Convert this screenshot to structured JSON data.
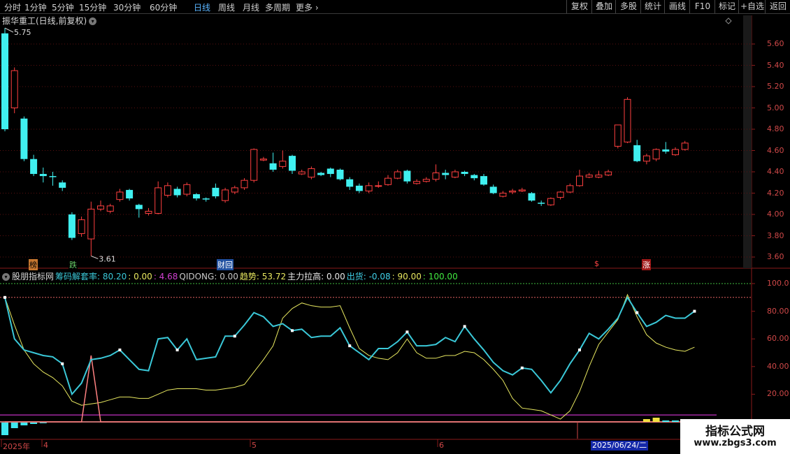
{
  "toolbar": {
    "periods": [
      "分时",
      "1分钟",
      "5分钟",
      "15分钟",
      "30分钟",
      "60分钟",
      "日线",
      "周线",
      "月线",
      "多周期",
      "更多"
    ],
    "active_period": "日线",
    "right_buttons": [
      "复权",
      "叠加",
      "多股",
      "统计",
      "画线",
      "F10",
      "标记",
      "+自选",
      "返回"
    ]
  },
  "stock": {
    "title": "振华重工(日线,前复权)"
  },
  "price_axis": [
    "5.60",
    "5.40",
    "5.20",
    "5.00",
    "4.80",
    "4.60",
    "4.40",
    "4.20",
    "4.00",
    "3.80",
    "3.60"
  ],
  "price_markers": {
    "high": "5.75",
    "low": "3.61"
  },
  "signals": [
    "榜",
    "跌",
    "财",
    "回",
    "$",
    "涨"
  ],
  "indicator": {
    "name": "股朋指标网",
    "items": [
      {
        "label": "筹码解套率: ",
        "value": "80.20",
        "color": "#3ac8d8"
      },
      {
        "label": ": ",
        "value": "0.00",
        "color": "#e8e860"
      },
      {
        "label": ": ",
        "value": "4.68",
        "color": "#d040d0"
      },
      {
        "label": "QIDONG: ",
        "value": "0.00",
        "color": "#c8c8c8"
      },
      {
        "label": "趋势: ",
        "value": "53.72",
        "color": "#e8e860"
      },
      {
        "label": "主力拉高: ",
        "value": "0.00",
        "color": "#e8e8e8"
      },
      {
        "label": "出货: ",
        "value": "-0.08",
        "color": "#40d0e8"
      },
      {
        "label": ": ",
        "value": "90.00",
        "color": "#e8e860"
      },
      {
        "label": ": ",
        "value": "100.00",
        "color": "#40e840"
      }
    ]
  },
  "indicator_axis": [
    "100.0",
    "80.00",
    "60.00",
    "40.00",
    "20.00"
  ],
  "x_axis": {
    "labels": [
      "2025年",
      "4",
      "5",
      "6"
    ],
    "cursor_date": "2025/06/24/二"
  },
  "watermark": {
    "line1": "指标公式网",
    "line2": "www.zbgs3.com"
  },
  "chart_data": [
    {
      "type": "candlestick",
      "title": "振华重工(日线,前复权)",
      "ylim": [
        3.55,
        5.75
      ],
      "candles": [
        [
          5.7,
          4.8,
          5.75,
          4.78
        ],
        [
          5.0,
          5.35,
          5.38,
          4.95
        ],
        [
          4.9,
          4.52,
          4.92,
          4.5
        ],
        [
          4.52,
          4.38,
          4.56,
          4.36
        ],
        [
          4.38,
          4.36,
          4.44,
          4.3
        ],
        [
          4.36,
          4.35,
          4.4,
          4.27
        ],
        [
          4.3,
          4.25,
          4.32,
          4.22
        ],
        [
          4.0,
          3.78,
          4.02,
          3.76
        ],
        [
          3.82,
          3.95,
          3.98,
          3.79
        ],
        [
          3.77,
          4.05,
          4.12,
          3.61
        ],
        [
          4.05,
          4.08,
          4.13,
          4.03
        ],
        [
          4.03,
          4.08,
          4.1,
          4.01
        ],
        [
          4.14,
          4.21,
          4.24,
          4.12
        ],
        [
          4.23,
          4.15,
          4.24,
          4.13
        ],
        [
          4.09,
          4.05,
          4.1,
          3.97
        ],
        [
          4.01,
          4.03,
          4.06,
          3.99
        ],
        [
          4.01,
          4.25,
          4.31,
          4.0
        ],
        [
          4.18,
          4.27,
          4.3,
          4.16
        ],
        [
          4.24,
          4.18,
          4.26,
          4.16
        ],
        [
          4.19,
          4.28,
          4.3,
          4.17
        ],
        [
          4.19,
          4.15,
          4.2,
          4.13
        ],
        [
          4.15,
          4.14,
          4.16,
          4.12
        ],
        [
          4.25,
          4.17,
          4.29,
          4.15
        ],
        [
          4.13,
          4.23,
          4.25,
          4.11
        ],
        [
          4.21,
          4.25,
          4.27,
          4.19
        ],
        [
          4.25,
          4.32,
          4.34,
          4.23
        ],
        [
          4.32,
          4.61,
          4.62,
          4.3
        ],
        [
          4.51,
          4.52,
          4.54,
          4.5
        ],
        [
          4.48,
          4.42,
          4.58,
          4.4
        ],
        [
          4.45,
          4.5,
          4.6,
          4.43
        ],
        [
          4.55,
          4.41,
          4.56,
          4.38
        ],
        [
          4.38,
          4.4,
          4.42,
          4.37
        ],
        [
          4.35,
          4.43,
          4.45,
          4.33
        ],
        [
          4.39,
          4.37,
          4.4,
          4.36
        ],
        [
          4.43,
          4.38,
          4.44,
          4.35
        ],
        [
          4.42,
          4.33,
          4.43,
          4.32
        ],
        [
          4.33,
          4.26,
          4.35,
          4.23
        ],
        [
          4.27,
          4.22,
          4.29,
          4.2
        ],
        [
          4.22,
          4.27,
          4.3,
          4.2
        ],
        [
          4.27,
          4.27,
          4.31,
          4.25
        ],
        [
          4.28,
          4.34,
          4.37,
          4.27
        ],
        [
          4.34,
          4.4,
          4.42,
          4.33
        ],
        [
          4.41,
          4.31,
          4.42,
          4.29
        ],
        [
          4.29,
          4.31,
          4.33,
          4.28
        ],
        [
          4.31,
          4.33,
          4.35,
          4.3
        ],
        [
          4.33,
          4.39,
          4.47,
          4.31
        ],
        [
          4.39,
          4.37,
          4.42,
          4.33
        ],
        [
          4.35,
          4.4,
          4.42,
          4.34
        ],
        [
          4.4,
          4.38,
          4.41,
          4.36
        ],
        [
          4.37,
          4.34,
          4.38,
          4.32
        ],
        [
          4.36,
          4.28,
          4.38,
          4.27
        ],
        [
          4.26,
          4.2,
          4.28,
          4.19
        ],
        [
          4.17,
          4.2,
          4.22,
          4.16
        ],
        [
          4.21,
          4.22,
          4.24,
          4.19
        ],
        [
          4.22,
          4.23,
          4.25,
          4.21
        ],
        [
          4.2,
          4.13,
          4.21,
          4.12
        ],
        [
          4.11,
          4.1,
          4.13,
          4.08
        ],
        [
          4.09,
          4.15,
          4.16,
          4.08
        ],
        [
          4.16,
          4.21,
          4.22,
          4.14
        ],
        [
          4.21,
          4.27,
          4.29,
          4.2
        ],
        [
          4.27,
          4.36,
          4.42,
          4.26
        ],
        [
          4.35,
          4.37,
          4.39,
          4.34
        ],
        [
          4.35,
          4.37,
          4.41,
          4.34
        ],
        [
          4.37,
          4.4,
          4.42,
          4.36
        ],
        [
          4.64,
          4.84,
          4.84,
          4.62
        ],
        [
          4.68,
          5.08,
          5.1,
          4.67
        ],
        [
          4.65,
          4.5,
          4.7,
          4.49
        ],
        [
          4.5,
          4.55,
          4.57,
          4.47
        ],
        [
          4.52,
          4.61,
          4.62,
          4.5
        ],
        [
          4.61,
          4.59,
          4.68,
          4.57
        ],
        [
          4.56,
          4.61,
          4.63,
          4.55
        ],
        [
          4.61,
          4.67,
          4.69,
          4.6
        ]
      ]
    },
    {
      "type": "line",
      "title": "股朋指标网",
      "ylim": [
        0,
        105
      ],
      "reference_lines": [
        100,
        90
      ],
      "series": [
        {
          "name": "筹码解套率",
          "color": "#3ac8d8",
          "values": [
            90,
            60,
            52,
            50,
            48,
            47,
            42,
            20,
            28,
            45,
            46,
            48,
            52,
            45,
            38,
            37,
            60,
            61,
            52,
            60,
            45,
            46,
            47,
            62,
            62,
            70,
            79,
            76,
            69,
            71,
            66,
            67,
            61,
            62,
            62,
            68,
            55,
            50,
            45,
            53,
            53,
            58,
            65,
            55,
            55,
            56,
            61,
            58,
            69,
            60,
            52,
            43,
            37,
            34,
            39,
            38,
            30,
            21,
            30,
            42,
            52,
            64,
            60,
            67,
            75,
            90,
            79,
            69,
            72,
            77,
            75,
            75,
            80
          ]
        },
        {
          "name": "趋势",
          "color": "#e8e860",
          "values": [
            90,
            70,
            52,
            42,
            36,
            32,
            26,
            15,
            12,
            13,
            14,
            16,
            18,
            18,
            17,
            17,
            20,
            23,
            24,
            24,
            24,
            23,
            23,
            24,
            25,
            27,
            36,
            45,
            55,
            75,
            82,
            86,
            84,
            83,
            83,
            84,
            68,
            53,
            48,
            46,
            45,
            50,
            60,
            50,
            46,
            46,
            48,
            48,
            51,
            50,
            45,
            38,
            30,
            17,
            10,
            9,
            8,
            5,
            2,
            8,
            22,
            40,
            56,
            65,
            74,
            92,
            76,
            63,
            57,
            54,
            52,
            51,
            54
          ]
        },
        {
          "name": "QIDONG",
          "color": "#ff8080",
          "values": [
            0,
            0,
            0,
            0,
            0,
            0,
            0,
            0,
            0,
            48,
            0,
            0,
            0,
            0,
            0,
            0,
            0,
            0,
            0,
            0,
            0,
            0,
            0,
            0,
            0,
            0,
            0,
            0,
            0,
            0,
            0,
            0,
            0,
            0,
            0,
            0,
            0,
            0,
            0,
            0,
            0,
            0,
            0,
            0,
            0,
            0,
            0,
            0,
            0,
            0,
            0,
            0,
            0,
            0,
            0,
            0,
            0,
            0,
            0,
            0,
            0,
            0,
            0,
            0,
            0,
            0,
            0,
            0,
            0,
            0,
            0,
            0,
            0
          ]
        }
      ]
    }
  ]
}
